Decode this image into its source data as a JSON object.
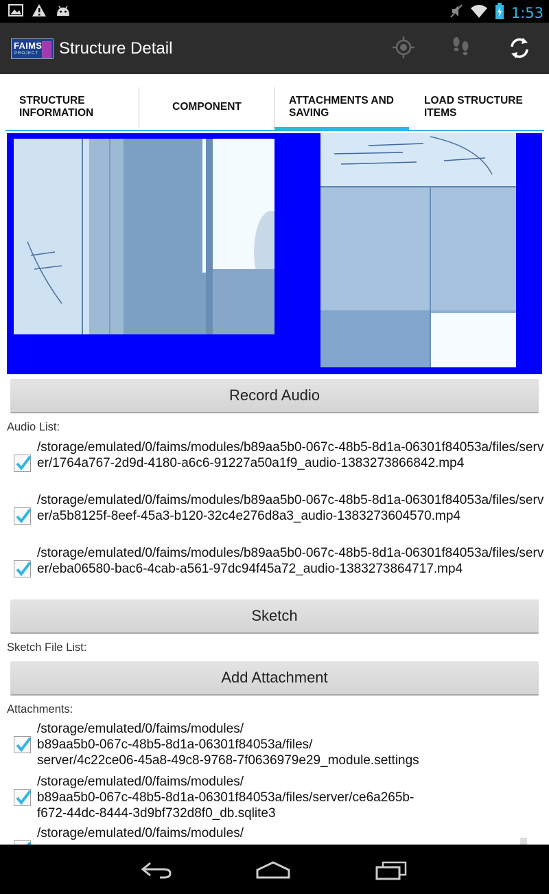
{
  "status_bar": {
    "time": "1:53",
    "left_icons": [
      "image-icon",
      "warning-icon",
      "android-icon"
    ],
    "right_icons": [
      "mute-icon",
      "wifi-icon",
      "battery-charging-icon"
    ]
  },
  "action_bar": {
    "logo_text": "FAIMS",
    "logo_sub": "PROJECT",
    "title": "Structure Detail",
    "icons": [
      "gps-icon",
      "footsteps-icon",
      "sync-icon"
    ]
  },
  "tabs": [
    {
      "label_line1": "STRUCTURE",
      "label_line2": "INFORMATION",
      "active": false
    },
    {
      "label_line1": "COMPONENT",
      "label_line2": "",
      "active": false
    },
    {
      "label_line1": "ATTACHMENTS AND",
      "label_line2": "SAVING",
      "active": true
    },
    {
      "label_line1": "LOAD STRUCTURE",
      "label_line2": "ITEMS",
      "active": false
    }
  ],
  "colors": {
    "accent": "#33b5e5",
    "photo_panel_bg": "#0000ff",
    "action_bar_bg": "#2d2d2d"
  },
  "record_audio_button": "Record Audio",
  "audio_list": {
    "label": "Audio List:",
    "items": [
      {
        "checked": true,
        "path": "/storage/emulated/0/faims/modules/b89aa5b0-067c-48b5-8d1a-06301f84053a/files/server/1764a767-2d9d-4180-a6c6-91227a50a1f9_audio-1383273866842.mp4"
      },
      {
        "checked": true,
        "path": "/storage/emulated/0/faims/modules/b89aa5b0-067c-48b5-8d1a-06301f84053a/files/server/a5b8125f-8eef-45a3-b120-32c4e276d8a3_audio-1383273604570.mp4"
      },
      {
        "checked": true,
        "path": "/storage/emulated/0/faims/modules/b89aa5b0-067c-48b5-8d1a-06301f84053a/files/server/eba06580-bac6-4cab-a561-97dc94f45a72_audio-1383273864717.mp4"
      }
    ]
  },
  "sketch_button": "Sketch",
  "sketch_list": {
    "label": "Sketch File List:"
  },
  "add_attachment_button": "Add Attachment",
  "attachments": {
    "label": "Attachments:",
    "items": [
      {
        "checked": true,
        "line1": "/storage/emulated/0/faims/modules/",
        "line2": "b89aa5b0-067c-48b5-8d1a-06301f84053a/files/",
        "line3": "server/4c22ce06-45a8-49c8-9768-7f0636979e29_module.settings"
      },
      {
        "checked": true,
        "line1": "/storage/emulated/0/faims/modules/",
        "line2": "b89aa5b0-067c-48b5-8d1a-06301f84053a/files/server/ce6a265b-",
        "line3": "f672-44dc-8444-3d9bf732d8f0_db.sqlite3"
      },
      {
        "checked": true,
        "line1": "/storage/emulated/0/faims/modules/",
        "line2": "",
        "line3": ""
      }
    ]
  },
  "nav_bar": {
    "icons": [
      "back-icon",
      "home-icon",
      "recent-apps-icon"
    ]
  }
}
